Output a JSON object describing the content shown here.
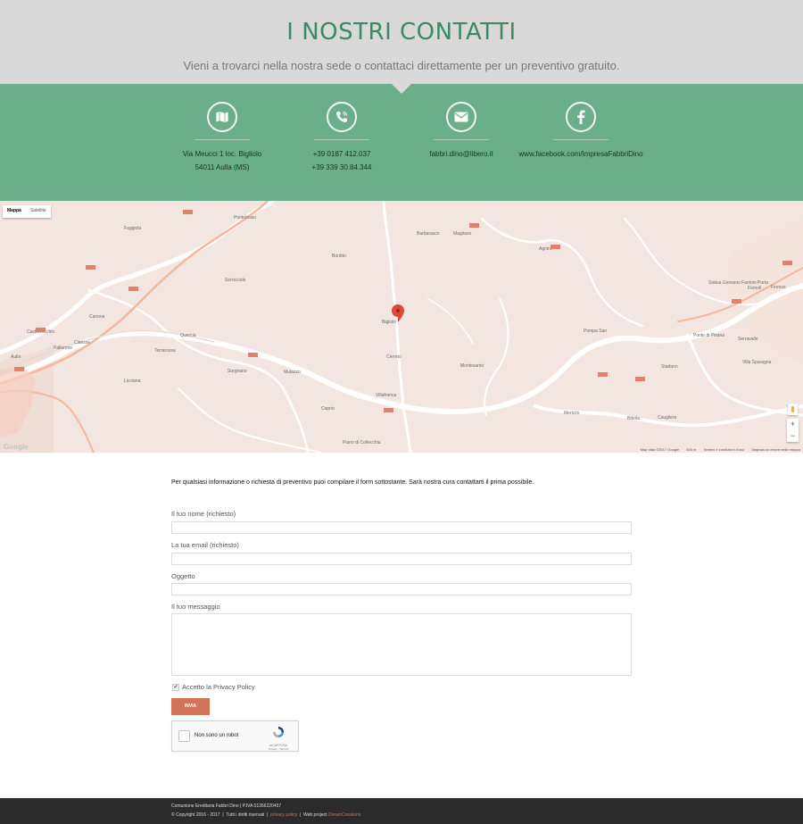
{
  "header": {
    "title": "I NOSTRI CONTATTI",
    "subtitle": "Vieni a trovarci nella nostra sede o contattaci direttamente per un preventivo gratuito."
  },
  "contacts": {
    "address": {
      "icon": "map-icon",
      "line1": "Via Meucci 1 loc. Bigliolo",
      "line2": "54011 Aulla (MS)"
    },
    "phone": {
      "icon": "phone-icon",
      "line1": "+39 0187 412.037",
      "line2": "+39 339 30.84.344"
    },
    "email": {
      "icon": "envelope-icon",
      "line1": "fabbri.dino@libero.it"
    },
    "facebook": {
      "icon": "facebook-icon",
      "line1": "www.facebook.com/ImpresaFabbriDino"
    }
  },
  "map": {
    "type_map": "Mappa",
    "type_satellite": "Satellite",
    "logo": "Google",
    "attrib_data": "Map data ©2017 Google",
    "attrib_scale": "500 m",
    "attrib_terms": "Termini e condizioni d'uso",
    "attrib_report": "Segnala un errore nella mappa",
    "zoom_in": "+",
    "zoom_out": "−",
    "labels": {
      "pontebosio": "Pontebosio",
      "serricciolo": "Serricciolo",
      "bigliolo": "Bigliolo",
      "bordito": "Bordito",
      "magliano": "Magliano",
      "agnino": "Agnino",
      "fornoli": "Fornoli",
      "villafranca": "Villafranca",
      "terrarossa": "Terrarossa",
      "mulazzo": "Mulazzo",
      "quercia": "Quercia",
      "cimaserra": "Caprio",
      "licciana": "Licciana",
      "aulla": "Aulla",
      "canova": "Canova",
      "pallerone": "Pallerone",
      "aggiunto": "Pompa San",
      "bibola": "Bibola",
      "caugliere": "Caugliere",
      "firenze": "Firenze",
      "antonio": "Statua Giovanni Fantoni Porta",
      "pisana": "Ponte di Pisana",
      "serravalle": "Serravalle",
      "villa": "Villa Sparagna",
      "stadano": "Stadano",
      "merizzo": "Merizzo",
      "montesanto": "Montesanto",
      "cerreto": "Cerreto",
      "pieve": "Piano di Collecchia",
      "barbarasco": "Barbarasco",
      "faggiola": "Faggiola",
      "clarisse": "Clarisse",
      "pontremoli": "Castelvecchio",
      "sorgnano": "Sorgnano"
    }
  },
  "form": {
    "intro": "Per qualsiasi informazione o richiesta di preventivo puoi compilare il form sottostante. Sarà nostra cura contattarti il prima possibile.",
    "name_label": "Il tuo nome (richiesto)",
    "email_label": "La tua email (richiesto)",
    "subject_label": "Oggetto",
    "message_label": "Il tuo messaggio",
    "privacy_label": "Accetto la Privacy Policy",
    "privacy_checked": true,
    "submit": "INVIA",
    "captcha_text": "Non sono un robot",
    "captcha_brand": "reCAPTCHA",
    "captcha_links": "Privacy - Termini"
  },
  "footer": {
    "line1": "Comunione Ereditaria Fabbri Dino  |  P.IVA 01356220457",
    "copyright": "© Copyright 2016 - 2017",
    "rights": "Tutti i diritti riservati",
    "privacy": "privacy policy",
    "webproject": "Web project",
    "agency": "DreamCreations"
  },
  "colors": {
    "title": "#3b8a63",
    "band": "#6baf8a",
    "button": "#d3735b",
    "footer": "#2b2b2b"
  }
}
